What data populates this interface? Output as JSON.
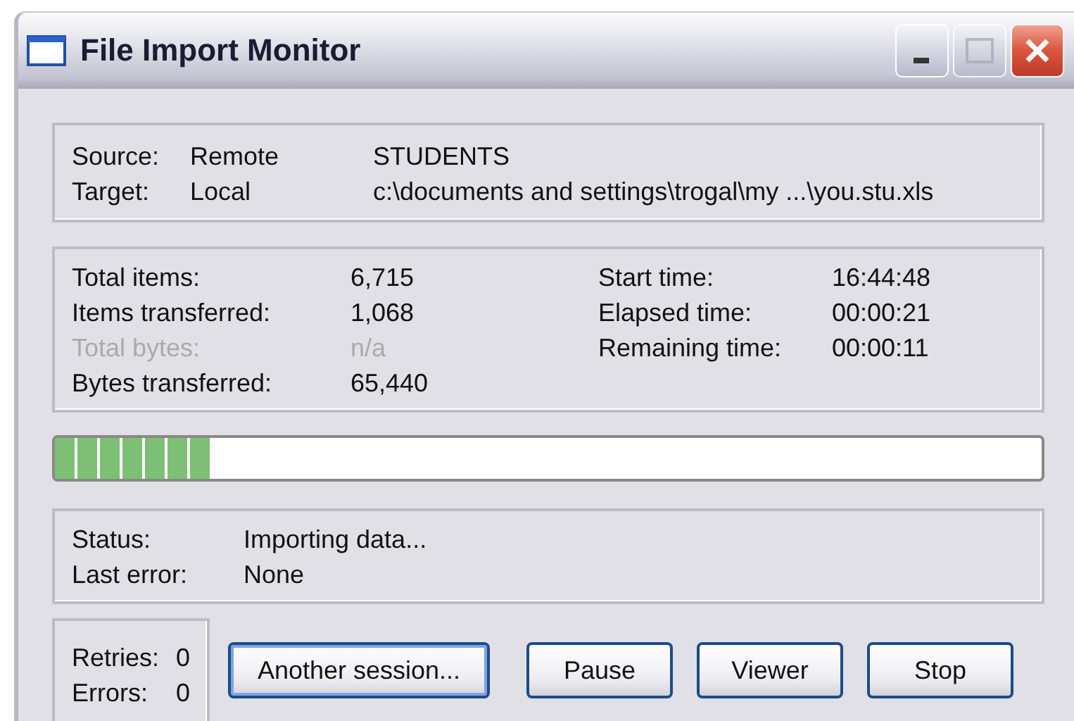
{
  "window": {
    "title": "File Import Monitor"
  },
  "connection": [
    {
      "label": "Source:",
      "location": "Remote",
      "path": "STUDENTS"
    },
    {
      "label": "Target:",
      "location": "Local",
      "path": "c:\\documents and settings\\trogal\\my ...\\you.stu.xls"
    }
  ],
  "counts": [
    {
      "label": "Total items:",
      "value": "6,715",
      "disabled": false
    },
    {
      "label": "Items transferred:",
      "value": "1,068",
      "disabled": false
    },
    {
      "label": "Total bytes:",
      "value": "n/a",
      "disabled": true
    },
    {
      "label": "Bytes transferred:",
      "value": "65,440",
      "disabled": false
    }
  ],
  "times": [
    {
      "label": "Start time:",
      "value": "16:44:48"
    },
    {
      "label": "Elapsed time:",
      "value": "00:00:21"
    },
    {
      "label": "Remaining time:",
      "value": "00:00:11"
    }
  ],
  "progress": {
    "level": 0.16
  },
  "status": [
    {
      "label": "Status:",
      "value": "Importing data..."
    },
    {
      "label": "Last error:",
      "value": "None"
    }
  ],
  "tallies": [
    {
      "label": "Retries:",
      "value": "0"
    },
    {
      "label": "Errors:",
      "value": "0"
    }
  ],
  "buttons": [
    {
      "label": "Another session...",
      "default": true
    },
    {
      "label": "Pause",
      "default": false
    },
    {
      "label": "Viewer",
      "default": false
    },
    {
      "label": "Stop",
      "default": false
    }
  ]
}
